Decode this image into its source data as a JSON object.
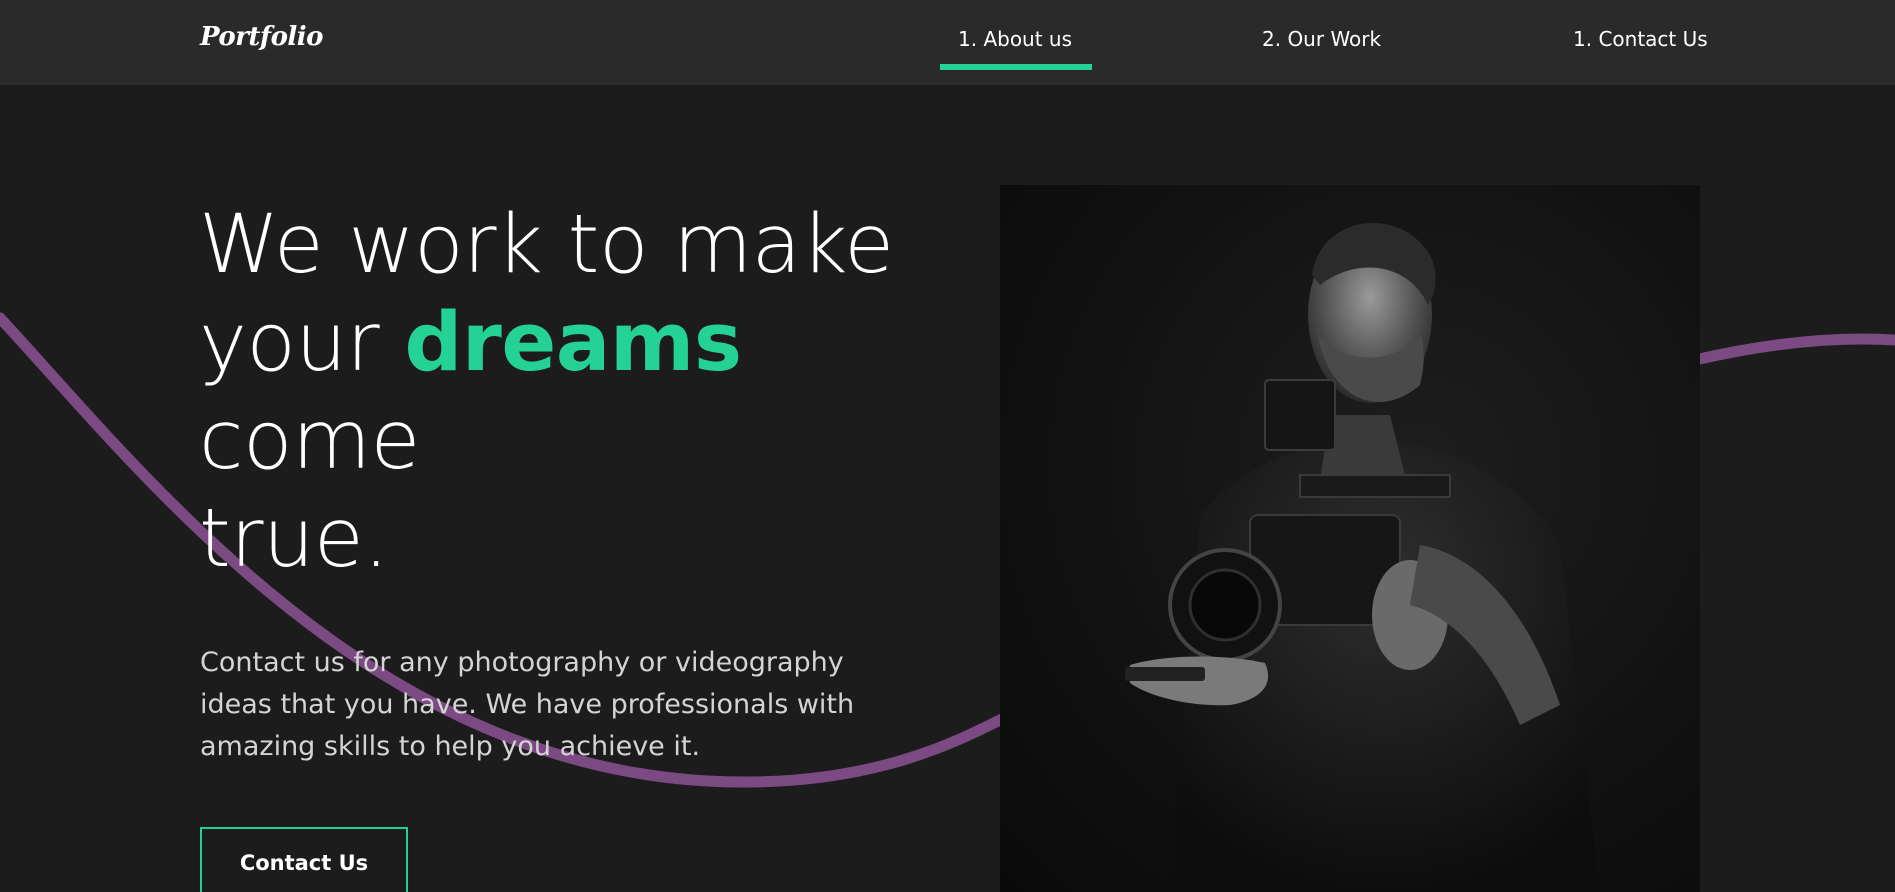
{
  "header": {
    "logo": "Portfolio",
    "nav": [
      {
        "label": "1. About us",
        "active": true
      },
      {
        "label": "2. Our Work",
        "active": false
      },
      {
        "label": "1. Contact Us",
        "active": false
      }
    ]
  },
  "hero": {
    "title_lines": [
      "We work to make",
      "your",
      "dreams",
      "come",
      "true."
    ],
    "description_lines": [
      "Contact us for any photography or videography",
      "ideas that you have. We have professionals with",
      "amazing skills to help you achieve it."
    ],
    "cta_label": "Contact Us",
    "photo_icon": "videographer-photo"
  },
  "colors": {
    "accent": "#25d295",
    "wave": "#7b4a82",
    "background": "#1c1c1d",
    "header_bg": "#2a2a2b"
  }
}
